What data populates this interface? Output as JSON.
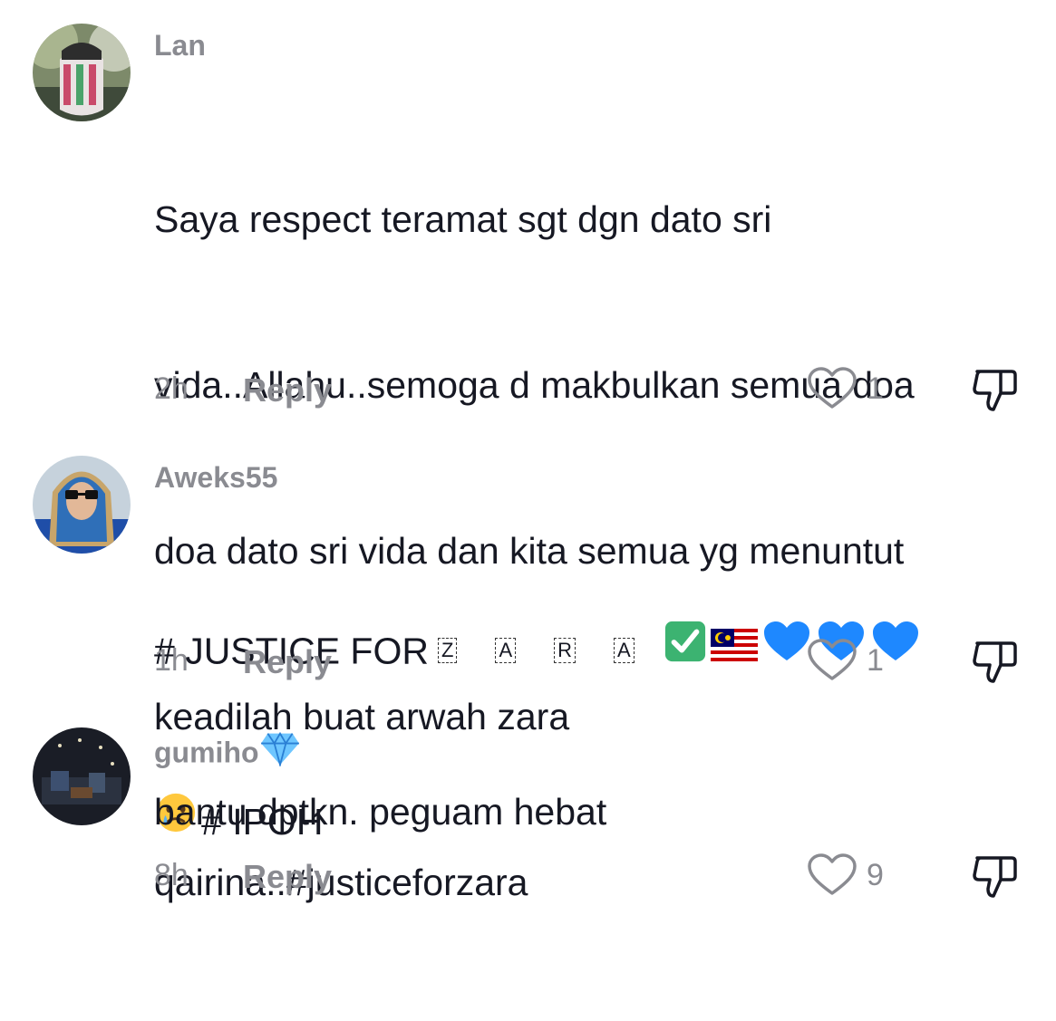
{
  "comments": [
    {
      "username": "Lan",
      "text": "Saya respect teramat sgt dgn dato sri vida..Allahu..semoga d makbulkan semua doa doa dato sri vida dan kita semua yg menuntut keadilah buat arwah zara qairina..#justiceforzara",
      "line1": "Saya respect teramat sgt dgn dato sri",
      "line2": "vida..Allahu..semoga d makbulkan semua doa",
      "line3": "doa dato sri vida dan kita semua yg menuntut",
      "line4": "keadilah buat arwah zara",
      "line5": "qairina..#justiceforzara",
      "time": "2h",
      "reply_label": "Reply",
      "likes": "1"
    },
    {
      "username": "Aweks55",
      "text_prefix": "# JUSTICE FOR",
      "boxed_letters": [
        "Z",
        "A",
        "R",
        "A"
      ],
      "emojis": [
        "check-mark-emoji",
        "malaysia-flag-emoji",
        "blue-heart-emoji",
        "blue-heart-emoji",
        "blue-heart-emoji",
        "crying-face-emoji"
      ],
      "text_suffix": "# IPOH",
      "time": "1h",
      "reply_label": "Reply",
      "likes": "1"
    },
    {
      "username": "gumiho",
      "username_badge": "gem-emoji",
      "text": "bantu dptkn. peguam hebat",
      "time": "8h",
      "reply_label": "Reply",
      "likes": "9"
    }
  ],
  "colors": {
    "text": "#161823",
    "muted": "#8a8b91",
    "blue_heart": "#1e88ff",
    "check_green": "#3cb371"
  }
}
